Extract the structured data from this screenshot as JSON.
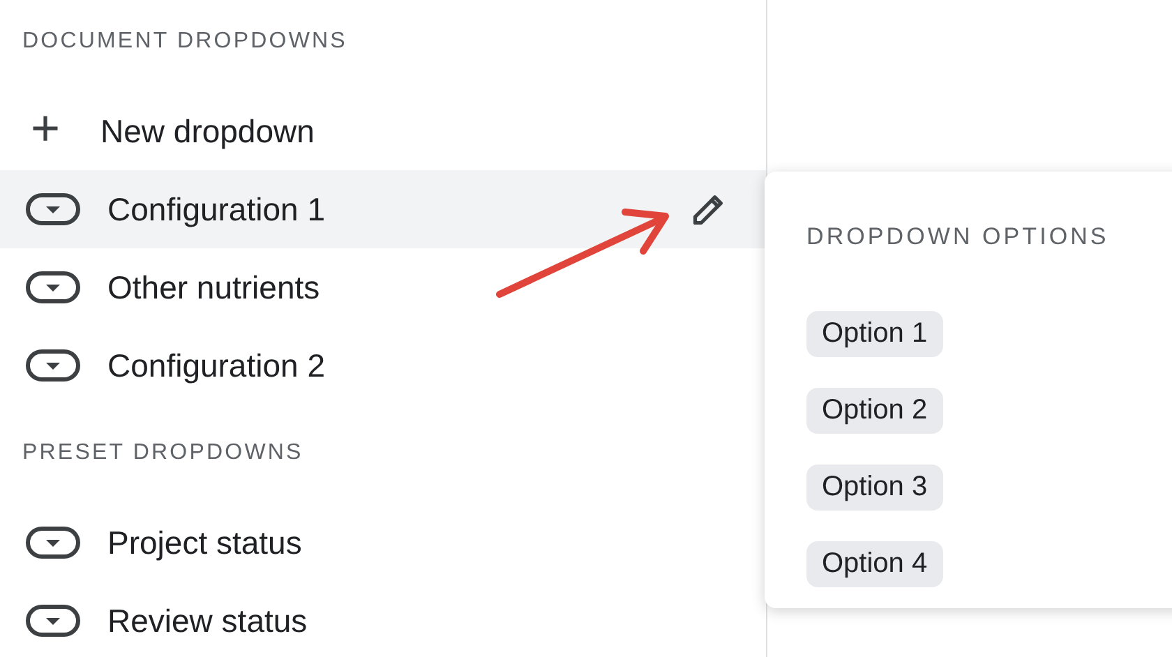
{
  "sections": [
    {
      "title": "DOCUMENT DROPDOWNS",
      "new_item": {
        "icon": "+",
        "label": "New dropdown"
      },
      "items": [
        {
          "label": "Configuration 1",
          "selected": true
        },
        {
          "label": "Other nutrients",
          "selected": false
        },
        {
          "label": "Configuration 2",
          "selected": false
        }
      ]
    },
    {
      "title": "PRESET DROPDOWNS",
      "items": [
        {
          "label": "Project status",
          "selected": false
        },
        {
          "label": "Review status",
          "selected": false
        }
      ]
    }
  ],
  "popover": {
    "title": "DROPDOWN OPTIONS",
    "options": [
      "Option 1",
      "Option 2",
      "Option 3",
      "Option 4"
    ]
  }
}
